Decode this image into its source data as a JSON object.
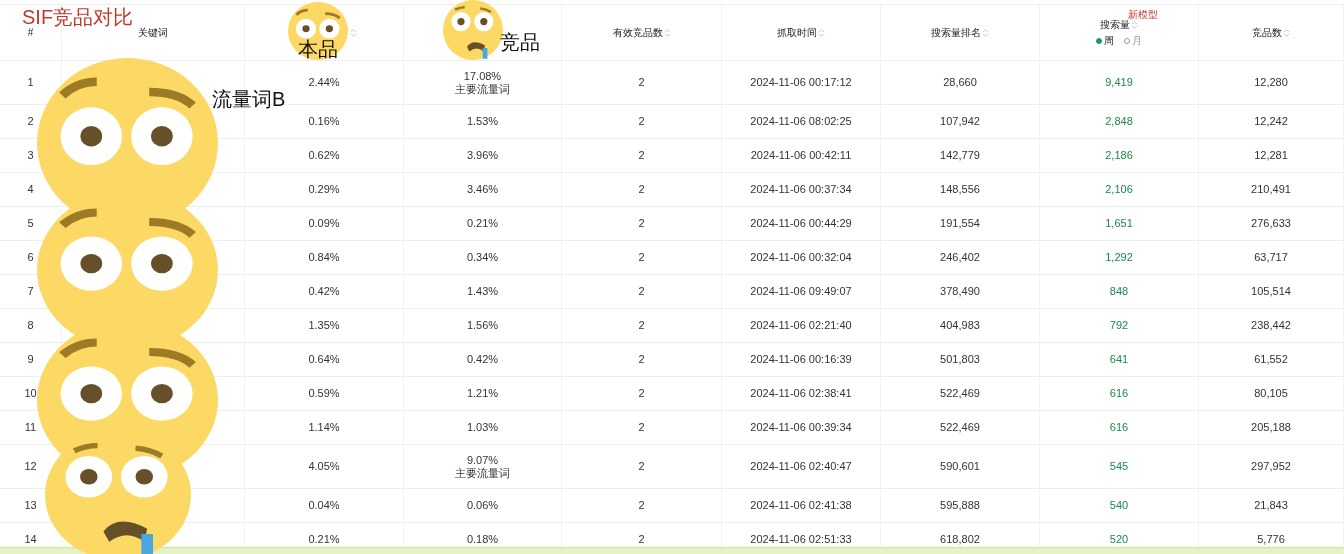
{
  "title": "SIF竞品对比",
  "table": {
    "columns": [
      {
        "label": "#",
        "sortable": false
      },
      {
        "label": "关键词",
        "sortable": false
      },
      {
        "sortable": true
      },
      {
        "sortable": false
      },
      {
        "label": "有效竞品数",
        "sortable": true
      },
      {
        "label": "抓取时间",
        "sortable": true
      },
      {
        "label": "搜索量排名",
        "sortable": true
      },
      {
        "label": "搜索量",
        "sortable": true,
        "tag": "新模型",
        "options": [
          {
            "label": "周",
            "selected": true
          },
          {
            "label": "月",
            "selected": false
          }
        ]
      },
      {
        "label": "竞品数",
        "sortable": true
      }
    ],
    "rows": [
      {
        "index": "1",
        "column_3": "2.44%",
        "column_4": "17.08%",
        "note": "主要流量词",
        "competitors": "2",
        "time": "2024-11-06 00:17:12",
        "rank": "28,660",
        "volume": "9,419",
        "count": "12,280"
      },
      {
        "index": "2",
        "column_3": "0.16%",
        "column_4": "1.53%",
        "competitors": "2",
        "time": "2024-11-06 08:02:25",
        "rank": "107,942",
        "volume": "2,848",
        "count": "12,242"
      },
      {
        "index": "3",
        "column_3": "0.62%",
        "column_4": "3.96%",
        "competitors": "2",
        "time": "2024-11-06 00:42:11",
        "rank": "142,779",
        "volume": "2,186",
        "count": "12,281"
      },
      {
        "index": "4",
        "column_3": "0.29%",
        "column_4": "3.46%",
        "competitors": "2",
        "time": "2024-11-06 00:37:34",
        "rank": "148,556",
        "volume": "2,106",
        "count": "210,491"
      },
      {
        "index": "5",
        "column_3": "0.09%",
        "column_4": "0.21%",
        "competitors": "2",
        "time": "2024-11-06 00:44:29",
        "rank": "191,554",
        "volume": "1,651",
        "count": "276,633"
      },
      {
        "index": "6",
        "column_3": "0.84%",
        "column_4": "0.34%",
        "competitors": "2",
        "time": "2024-11-06 00:32:04",
        "rank": "246,402",
        "volume": "1,292",
        "count": "63,717"
      },
      {
        "index": "7",
        "column_3": "0.42%",
        "column_4": "1.43%",
        "competitors": "2",
        "time": "2024-11-06 09:49:07",
        "rank": "378,490",
        "volume": "848",
        "count": "105,514"
      },
      {
        "index": "8",
        "column_3": "1.35%",
        "column_4": "1.56%",
        "competitors": "2",
        "time": "2024-11-06 02:21:40",
        "rank": "404,983",
        "volume": "792",
        "count": "238,442"
      },
      {
        "index": "9",
        "column_3": "0.64%",
        "column_4": "0.42%",
        "competitors": "2",
        "time": "2024-11-06 00:16:39",
        "rank": "501,803",
        "volume": "641",
        "count": "61,552"
      },
      {
        "index": "10",
        "column_3": "0.59%",
        "column_4": "1.21%",
        "competitors": "2",
        "time": "2024-11-06 02:38:41",
        "rank": "522,469",
        "volume": "616",
        "count": "80,105"
      },
      {
        "index": "11",
        "column_3": "1.14%",
        "column_4": "1.03%",
        "competitors": "2",
        "time": "2024-11-06 00:39:34",
        "rank": "522,469",
        "volume": "616",
        "count": "205,188"
      },
      {
        "index": "12",
        "column_3": "4.05%",
        "column_4": "9.07%",
        "note": "主要流量词",
        "competitors": "2",
        "time": "2024-11-06 02:40:47",
        "rank": "590,601",
        "volume": "545",
        "count": "297,952"
      },
      {
        "index": "13",
        "column_3": "0.04%",
        "column_4": "0.06%",
        "competitors": "2",
        "time": "2024-11-06 02:41:38",
        "rank": "595,888",
        "volume": "540",
        "count": "21,843"
      },
      {
        "index": "14",
        "column_3": "0.21%",
        "column_4": "0.18%",
        "competitors": "2",
        "time": "2024-11-06 02:51:33",
        "rank": "618,802",
        "volume": "520",
        "count": "5,776"
      }
    ]
  },
  "stickers": [
    {
      "kind": "flushed"
    },
    {
      "kind": "fearful"
    },
    {
      "kind": "flushed"
    },
    {
      "kind": "flushed"
    },
    {
      "kind": "flushed"
    },
    {
      "kind": "fearful"
    }
  ],
  "overlay_labels": [
    "本品",
    "竞品",
    "流量词B"
  ]
}
